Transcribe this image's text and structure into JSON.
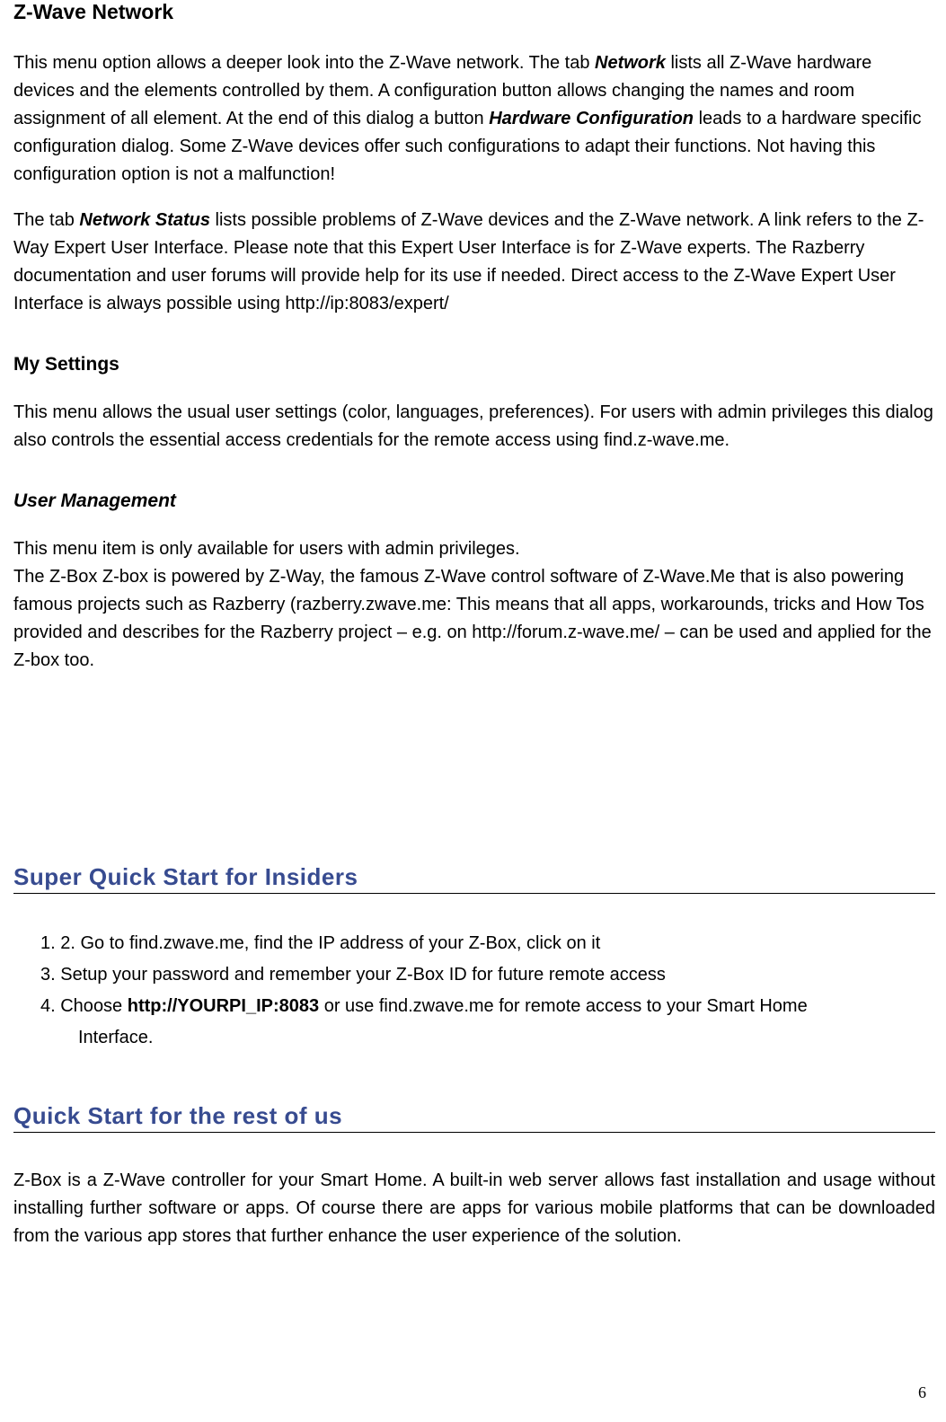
{
  "sections": {
    "zwave": {
      "title": "Z-Wave Network",
      "p1_before_net": "This menu option allows a deeper look into the Z-Wave network. The tab ",
      "net_label": "Network",
      "p1_mid": " lists all Z-Wave hardware devices and the elements controlled by them.  A configuration button allows changing the names and room assignment of all element. At the end of this dialog a button ",
      "hw_label": "Hardware Configuration",
      "p1_after_hw": " leads to a hardware specific configuration dialog. Some Z-Wave devices offer such configurations to adapt their functions. Not having this configuration option is not a malfunction!",
      "p2_before_ns": "The tab ",
      "ns_label": "Network Status",
      "p2_after_ns": " lists possible problems of Z-Wave devices and the Z-Wave network. A link refers to the Z- Way Expert User Interface. Please note that this Expert User Interface is for Z-Wave experts. The Razberry documentation and user  forums will provide help for its use  if needed. Direct access to the Z-Wave Expert User Interface is always possible using http://ip:8083/expert/"
    },
    "mysettings": {
      "title": "My Settings",
      "p1": "This menu  allows the usual  user  settings (color, languages, preferences). For users with admin privileges this dialog also controls the essential access credentials for the remote access using find.z-wave.me."
    },
    "usermgmt": {
      "title": "User Management",
      "p1": "This menu item is only available for users with admin privileges.",
      "p2": "The Z-Box Z-box is powered by Z-Way, the famous Z-Wave control software of Z-Wave.Me  that is also powering famous projects such as Razberry (razberry.zwave.me: This means that all apps, workarounds, tricks and How Tos provided and describes for the Razberry project – e.g. on http://forum.z-wave.me/ – can be used and applied for the Z-box too."
    },
    "quick_insiders": {
      "title": "Super Quick Start for Insiders",
      "step12_pre": "1. 2. Go  to  fi",
      "step12_bold": "nd.zwave.me, ",
      "step12_mid": "fin",
      "step12_bold2": "d the ",
      "step12_mid2": "IP addr",
      "step12_bold3": "ess ",
      "step12_post": "of your  Z-Box, click on  it",
      "step3_pre": "3. Set",
      "step3_b1": "up ",
      "step3_m1": "your  passwo",
      "step3_b2": "rd ",
      "step3_m2": "and remem",
      "step3_b3": "ber ",
      "step3_m3": "your  Z-Box ID for futu",
      "step3_b4": "re remote acce",
      "step3_post": "ss",
      "step4_pre": "4. Cho",
      "step4_b1": "ose ",
      "step4_url": "http://YOURPI_IP:8083",
      "step4_m1": " or  use fi",
      "step4_b2": "nd.zwave.me ",
      "step4_m2": "for  remote  acce",
      "step4_b3": "ss ",
      "step4_m3": "to  your  Smart Home",
      "step4_tail": "Interface."
    },
    "quick_rest": {
      "title": "Quick Start for the rest of us",
      "p1": "Z-Box   is   a   Z-Wave   controller   for   your   Smart   Home.   A   built-in   web   server   allows   fast installation  and   usage   without   installing   further   software   or   apps.   Of   course   there   are apps   for   various   mobile   platforms   that   can   be   downloaded   from  the   various   app   stores that further enhance the user experience of the solution."
    }
  },
  "page_number": "6"
}
